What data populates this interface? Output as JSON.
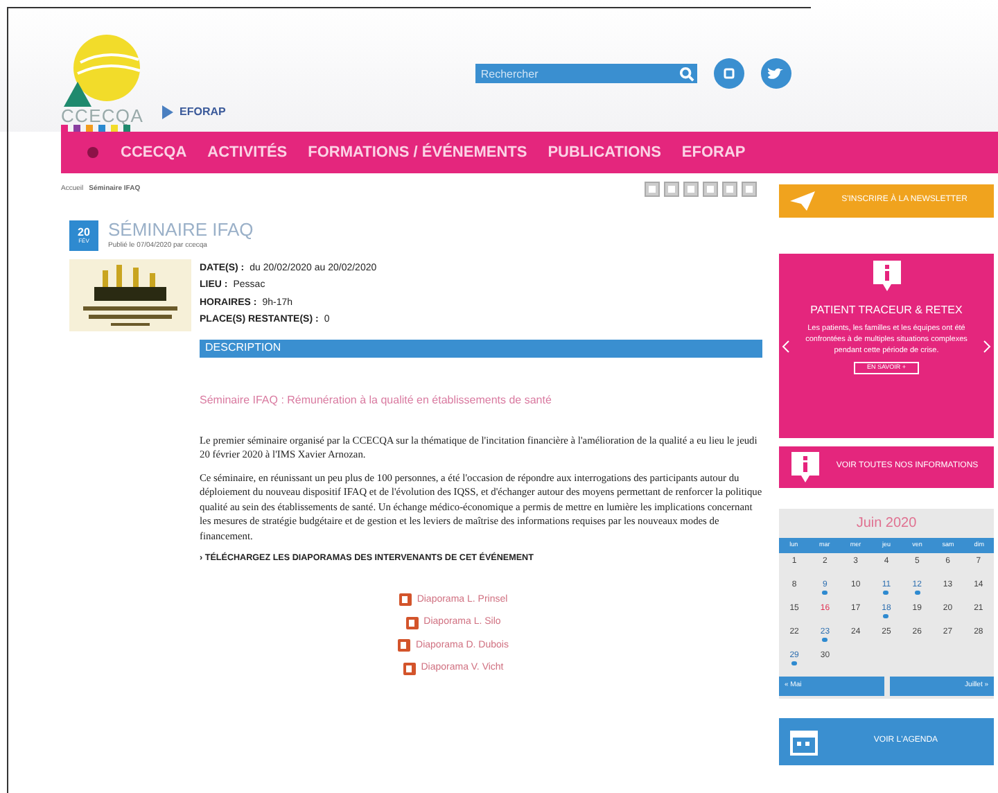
{
  "header": {
    "logo_text": "CCECQA",
    "partner_logo_text": "EFORAP",
    "search": {
      "placeholder": "Rechercher"
    }
  },
  "nav": {
    "items": [
      {
        "label": "CCECQA",
        "selected": false
      },
      {
        "label": "ACTIVITÉS",
        "selected": false
      },
      {
        "label": "FORMATIONS / ÉVÉNEMENTS",
        "selected": false
      },
      {
        "label": "PUBLICATIONS",
        "selected": false
      },
      {
        "label": "EFORAP",
        "selected": false
      }
    ]
  },
  "breadcrumb": {
    "parent": "Accueil",
    "current": "Séminaire IFAQ"
  },
  "event": {
    "day": "20",
    "month": "FÉV",
    "title": "SÉMINAIRE IFAQ",
    "posted": "Publié le 07/04/2020 par ccecqa",
    "details": [
      {
        "label": "DATE(S) :",
        "value": "du 20/02/2020 au 20/02/2020"
      },
      {
        "label": "LIEU :",
        "value": "Pessac"
      },
      {
        "label": "HORAIRES :",
        "value": "9h-17h"
      },
      {
        "label": "PLACE(S) RESTANTE(S) :",
        "value": "0"
      }
    ],
    "section_title": "DESCRIPTION",
    "subtitle": "Séminaire IFAQ : Rémunération à la qualité en établissements de santé",
    "paragraphs": [
      "Le premier séminaire organisé par la CCECQA sur la thématique de l'incitation financière à l'amélioration de la qualité a eu lieu le jeudi 20 février 2020 à l'IMS Xavier Arnozan.",
      "Ce séminaire, en réunissant un peu plus de 100 personnes, a été l'occasion de répondre aux interrogations des participants autour du déploiement du nouveau dispositif IFAQ et de l'évolution des IQSS, et d'échanger autour des moyens permettant de renforcer la politique qualité au sein des établissements de santé. Un échange médico-économique a permis de mettre en lumière les implications concernant les mesures de stratégie budgétaire et de gestion et les leviers de maîtrise des informations requises par les nouveaux modes de financement."
    ],
    "downloads_title": "› TÉLÉCHARGEZ LES DIAPORAMAS DES INTERVENANTS DE CET ÉVÉNEMENT",
    "downloads": [
      "Diaporama L. Prinsel",
      "Diaporama L. Silo",
      "Diaporama D. Dubois",
      "Diaporama V. Vicht"
    ]
  },
  "sidebar": {
    "newsletter": "S'INSCRIRE À LA NEWSLETTER",
    "news_card": {
      "title": "PATIENT TRACEUR & RETEX",
      "text": "Les patients, les familles et les équipes ont été confrontées à de multiples situations complexes pendant cette période de crise.",
      "button": "EN SAVOIR +"
    },
    "all_news": "VOIR TOUTES NOS INFORMATIONS",
    "calendar": {
      "title": "Juin 2020",
      "weekdays": [
        "lun",
        "mar",
        "mer",
        "jeu",
        "ven",
        "sam",
        "dim"
      ],
      "days": [
        {
          "label": "1",
          "event": false,
          "selected": false
        },
        {
          "label": "2",
          "event": false,
          "selected": false
        },
        {
          "label": "3",
          "event": false,
          "selected": false
        },
        {
          "label": "4",
          "event": false,
          "selected": false
        },
        {
          "label": "5",
          "event": false,
          "selected": false
        },
        {
          "label": "6",
          "event": false,
          "selected": false
        },
        {
          "label": "7",
          "event": false,
          "selected": false
        },
        {
          "label": "8",
          "event": false,
          "selected": false
        },
        {
          "label": "9",
          "event": true,
          "selected": false
        },
        {
          "label": "10",
          "event": false,
          "selected": false
        },
        {
          "label": "11",
          "event": true,
          "selected": false
        },
        {
          "label": "12",
          "event": true,
          "selected": false
        },
        {
          "label": "13",
          "event": false,
          "selected": false
        },
        {
          "label": "14",
          "event": false,
          "selected": false
        },
        {
          "label": "15",
          "event": false,
          "selected": false
        },
        {
          "label": "16",
          "event": false,
          "selected": true
        },
        {
          "label": "17",
          "event": false,
          "selected": false
        },
        {
          "label": "18",
          "event": true,
          "selected": false
        },
        {
          "label": "19",
          "event": false,
          "selected": false
        },
        {
          "label": "20",
          "event": false,
          "selected": false
        },
        {
          "label": "21",
          "event": false,
          "selected": false
        },
        {
          "label": "22",
          "event": false,
          "selected": false
        },
        {
          "label": "23",
          "event": true,
          "selected": false
        },
        {
          "label": "24",
          "event": false,
          "selected": false
        },
        {
          "label": "25",
          "event": false,
          "selected": false
        },
        {
          "label": "26",
          "event": false,
          "selected": false
        },
        {
          "label": "27",
          "event": false,
          "selected": false
        },
        {
          "label": "28",
          "event": false,
          "selected": false
        },
        {
          "label": "29",
          "event": true,
          "selected": false
        },
        {
          "label": "30",
          "event": false,
          "selected": false
        }
      ],
      "prev": "« Mai",
      "next": "Juillet »"
    },
    "agenda": "VOIR L'AGENDA"
  }
}
